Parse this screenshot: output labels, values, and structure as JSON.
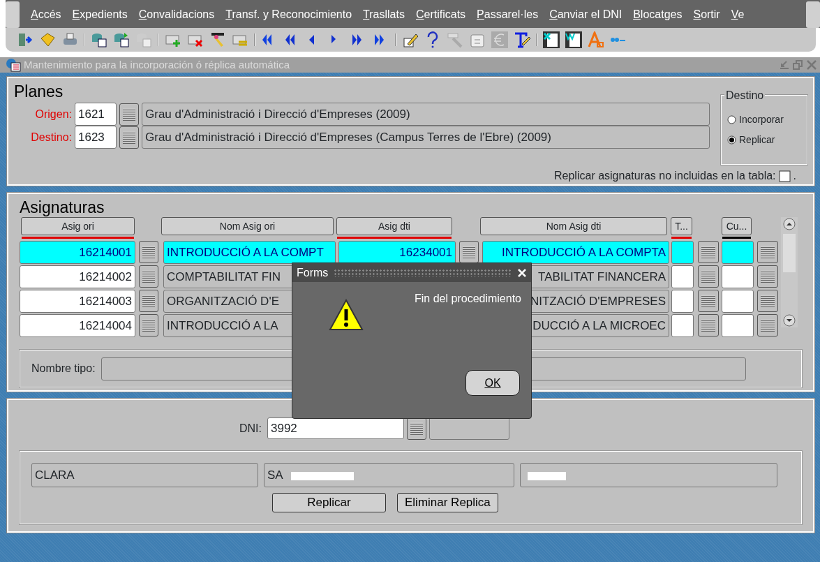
{
  "menu": [
    "Accés",
    "Expedients",
    "Convalidacions",
    "Transf. y Reconocimiento",
    "Trasllats",
    "Certificats",
    "Passarel·les",
    "Canviar el DNI",
    "Blocatges",
    "Sortir",
    "Ve"
  ],
  "window": {
    "title": "Mantenimiento para la incorporación ó réplica automática"
  },
  "planes": {
    "title": "Planes",
    "rows": [
      {
        "label": "Origen:",
        "code": "1621",
        "description": "Grau d'Administració i Direcció d'Empreses (2009)"
      },
      {
        "label": "Destino:",
        "code": "1623",
        "description": "Grau d'Administració i Direcció d'Empreses (Campus Terres de l'Ebre) (2009)"
      }
    ],
    "destino": {
      "title": "Destino",
      "options": [
        {
          "label": "Incorporar",
          "selected": false
        },
        {
          "label": "Replicar",
          "selected": true
        }
      ]
    },
    "replicar_no_incluidas": {
      "label": "Replicar asignaturas no incluidas en la tabla:",
      "checked": false,
      "suffix": "."
    }
  },
  "asignaturas": {
    "title": "Asignaturas",
    "columns": [
      {
        "label": "Asig ori",
        "color": "#e00000"
      },
      {
        "label": "Nom Asig ori"
      },
      {
        "label": "Asig dti",
        "color": "#e00000"
      },
      {
        "label": "Nom Asig dti"
      },
      {
        "label": "T...",
        "color": "#e00000"
      },
      {
        "label": "Cu...",
        "color": "#000000"
      }
    ],
    "rows": [
      {
        "selected": true,
        "asig_ori": "16214001",
        "nom_asig_ori": "INTRODUCCIÓ A LA COMPT",
        "asig_dti": "16234001",
        "nom_asig_dti": "INTRODUCCIÓ A LA COMPTA"
      },
      {
        "selected": false,
        "asig_ori": "16214002",
        "nom_asig_ori": "COMPTABILITAT FIN",
        "nom_asig_dti": "TABILITAT FINANCERA"
      },
      {
        "selected": false,
        "asig_ori": "16214003",
        "nom_asig_ori": "ORGANITZACIÓ D'E",
        "nom_asig_dti": "NITZACIÓ D'EMPRESES"
      },
      {
        "selected": false,
        "asig_ori": "16214004",
        "nom_asig_ori": "INTRODUCCIÓ A LA",
        "nom_asig_dti": "DUCCIÓ A LA MICROEC"
      }
    ],
    "nombre_tipo": {
      "label": "Nombre tipo:"
    }
  },
  "persona": {
    "dni": {
      "label": "DNI:",
      "value": "3992"
    },
    "nombre": "CLARA",
    "apellido_1": "SA",
    "buttons": [
      "Replicar",
      "Eliminar Replica"
    ]
  },
  "dialog": {
    "title": "Forms",
    "message": "Fin del procedimiento",
    "button": "OK"
  }
}
